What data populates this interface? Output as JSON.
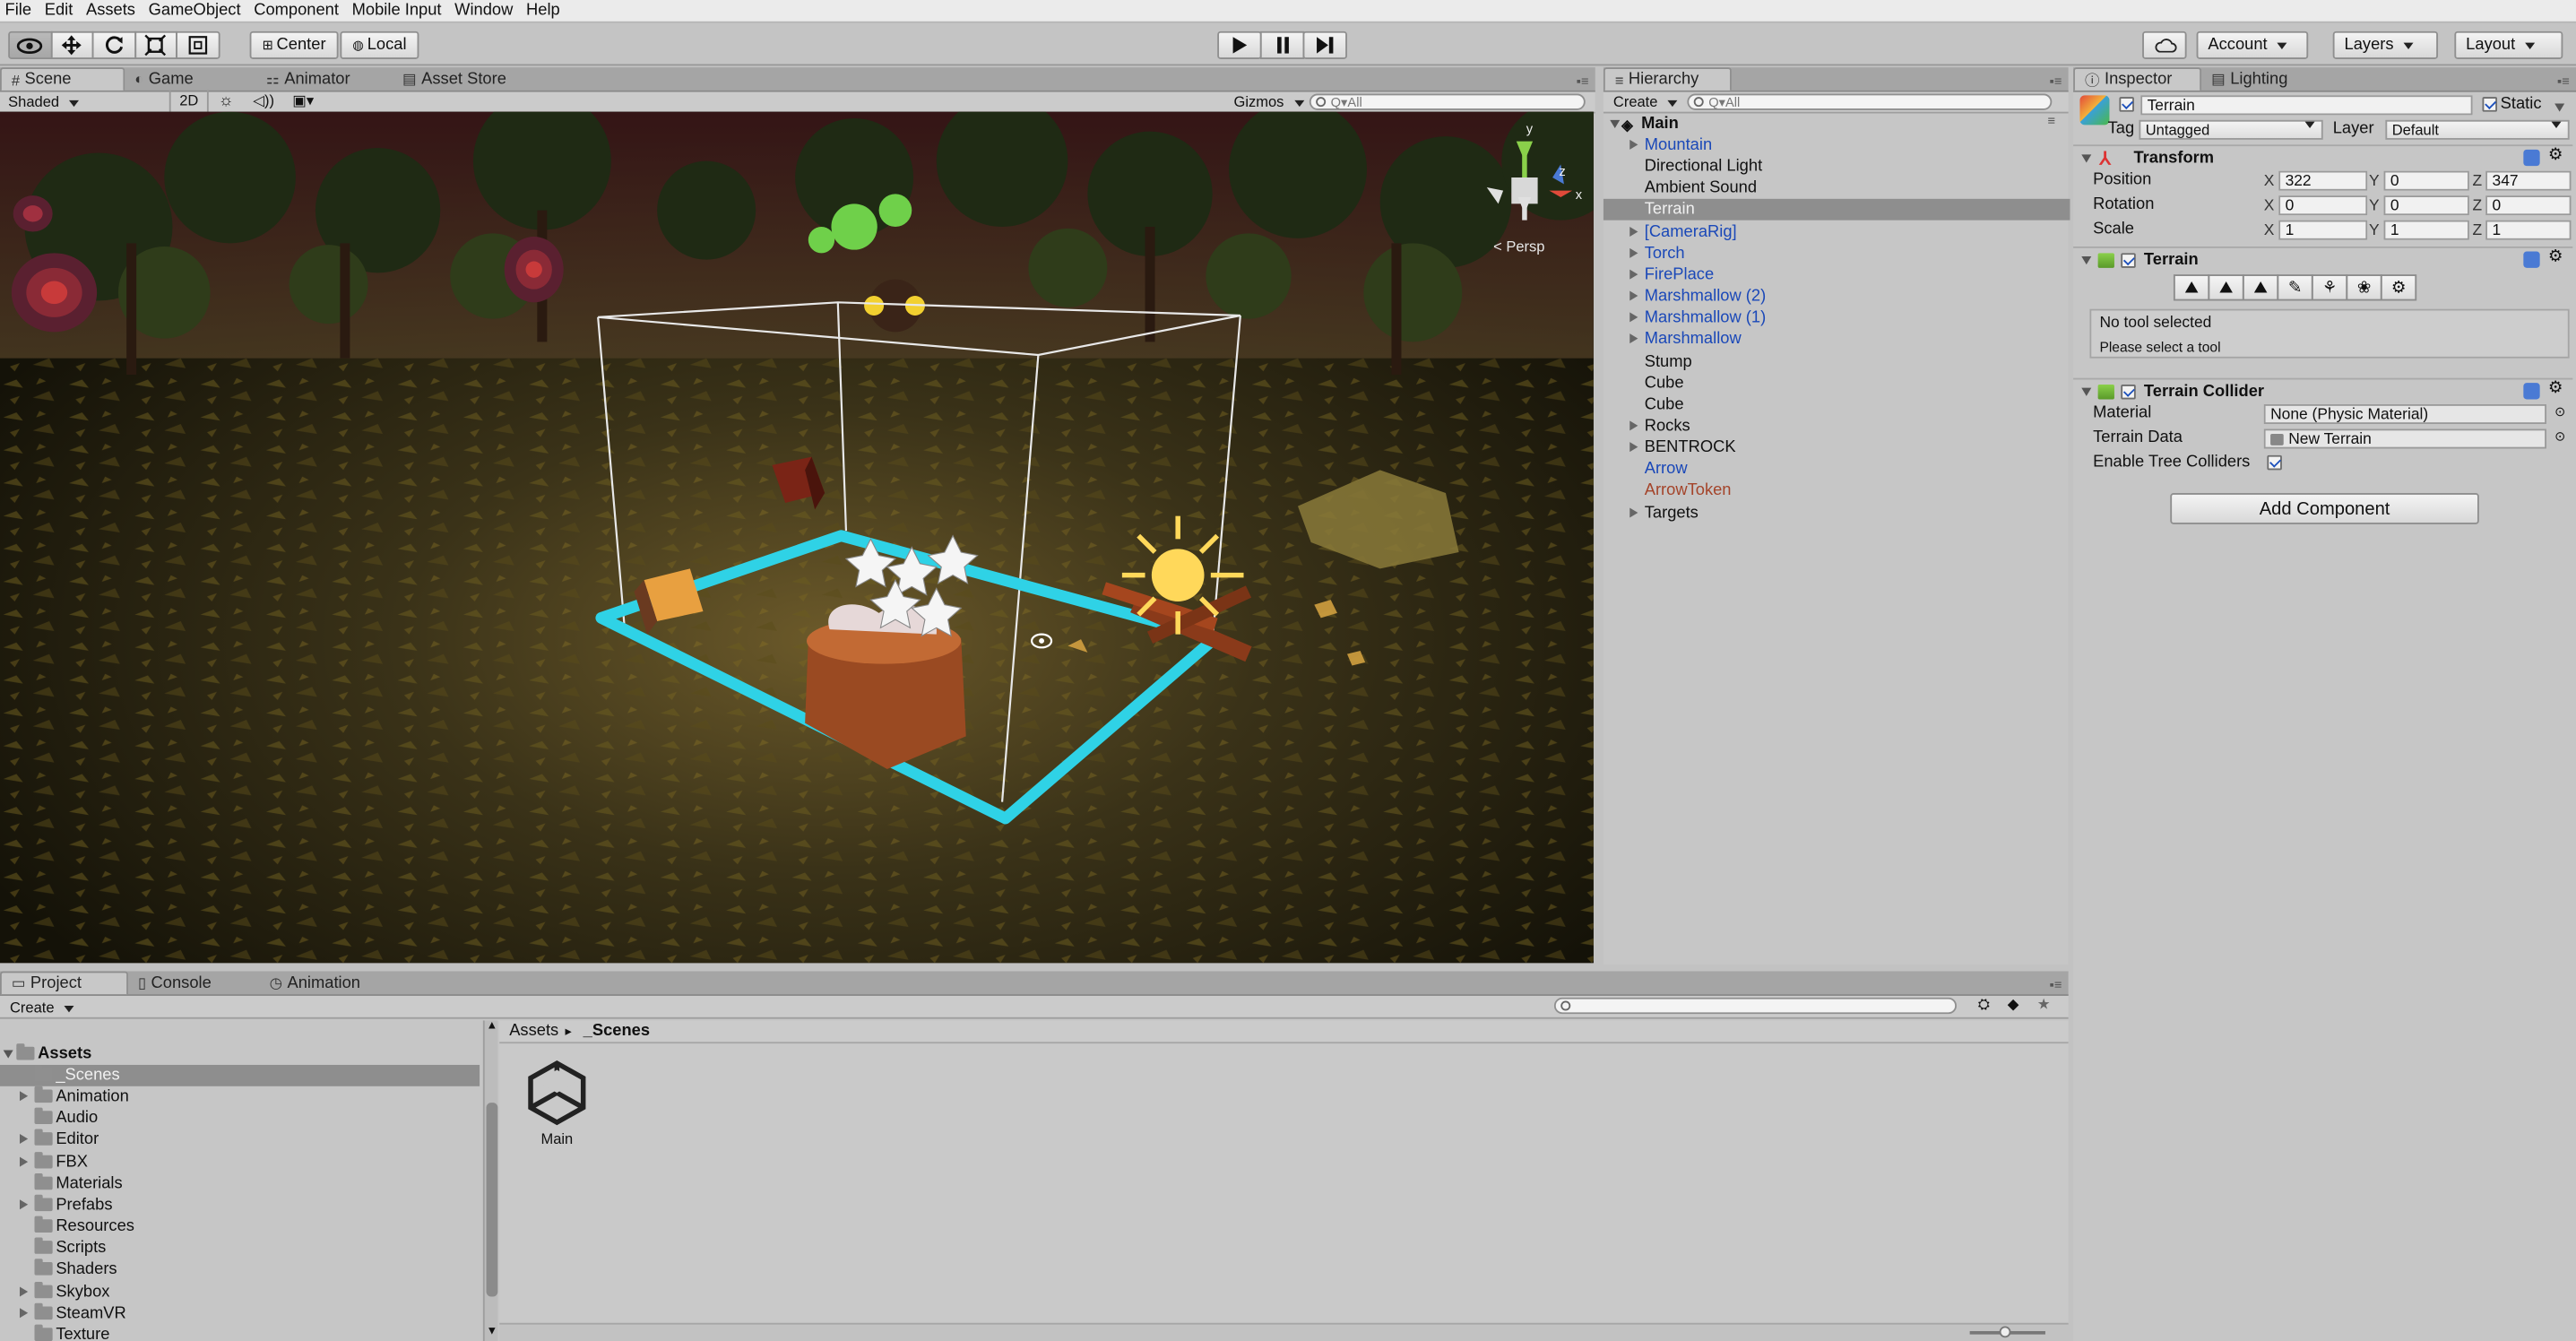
{
  "menu": [
    "File",
    "Edit",
    "Assets",
    "GameObject",
    "Component",
    "Mobile Input",
    "Window",
    "Help"
  ],
  "toolbar": {
    "tools": [
      "view-hand-icon",
      "move-icon",
      "rotate-icon",
      "scale-icon",
      "rect-icon"
    ],
    "pivot": "Center",
    "space": "Local",
    "account": "Account",
    "layers": "Layers",
    "layout": "Layout"
  },
  "scene": {
    "tabs": [
      "Scene",
      "Game",
      "Animator",
      "Asset Store"
    ],
    "shading": "Shaded",
    "mode2d": "2D",
    "gizmos": "Gizmos",
    "search_placeholder": "Q▾All",
    "persp": "Persp",
    "axis_y": "y",
    "axis_z": "z",
    "axis_x": "x"
  },
  "hierarchy": {
    "tab": "Hierarchy",
    "create": "Create",
    "search_placeholder": "Q▾All",
    "scene": "Main",
    "items": [
      {
        "label": "Mountain",
        "kind": "prefab",
        "expand": true
      },
      {
        "label": "Directional Light",
        "kind": "normal",
        "expand": false
      },
      {
        "label": "Ambient Sound",
        "kind": "normal",
        "expand": false
      },
      {
        "label": "Terrain",
        "kind": "normal",
        "expand": false,
        "selected": true
      },
      {
        "label": "[CameraRig]",
        "kind": "prefab",
        "expand": true
      },
      {
        "label": "Torch",
        "kind": "prefab",
        "expand": true
      },
      {
        "label": "FirePlace",
        "kind": "prefab",
        "expand": true
      },
      {
        "label": "Marshmallow (2)",
        "kind": "prefab",
        "expand": true
      },
      {
        "label": "Marshmallow (1)",
        "kind": "prefab",
        "expand": true
      },
      {
        "label": "Marshmallow",
        "kind": "prefab",
        "expand": true
      },
      {
        "label": "Stump",
        "kind": "normal",
        "expand": false
      },
      {
        "label": "Cube",
        "kind": "normal",
        "expand": false
      },
      {
        "label": "Cube",
        "kind": "normal",
        "expand": false
      },
      {
        "label": "Rocks",
        "kind": "normal",
        "expand": true
      },
      {
        "label": "BENTROCK",
        "kind": "normal",
        "expand": true
      },
      {
        "label": "Arrow",
        "kind": "prefab",
        "expand": false
      },
      {
        "label": "ArrowToken",
        "kind": "broken",
        "expand": false
      },
      {
        "label": "Targets",
        "kind": "normal",
        "expand": true
      }
    ]
  },
  "inspector": {
    "tabs": [
      "Inspector",
      "Lighting"
    ],
    "object_name": "Terrain",
    "static_label": "Static",
    "tag_label": "Tag",
    "tag_value": "Untagged",
    "layer_label": "Layer",
    "layer_value": "Default",
    "transform": {
      "title": "Transform",
      "position": {
        "label": "Position",
        "x": "322",
        "y": "0",
        "z": "347"
      },
      "rotation": {
        "label": "Rotation",
        "x": "0",
        "y": "0",
        "z": "0"
      },
      "scale": {
        "label": "Scale",
        "x": "1",
        "y": "1",
        "z": "1"
      }
    },
    "terrain": {
      "title": "Terrain",
      "tools": [
        "raise-terrain-icon",
        "paint-height-icon",
        "smooth-height-icon",
        "paint-texture-icon",
        "place-trees-icon",
        "paint-details-icon",
        "terrain-settings-icon"
      ],
      "msg1": "No tool selected",
      "msg2": "Please select a tool"
    },
    "collider": {
      "title": "Terrain Collider",
      "material_label": "Material",
      "material_value": "None (Physic Material)",
      "data_label": "Terrain Data",
      "data_value": "New Terrain",
      "trees_label": "Enable Tree Colliders"
    },
    "add_component": "Add Component"
  },
  "project": {
    "tabs": [
      "Project",
      "Console",
      "Animation"
    ],
    "create": "Create",
    "root": "Assets",
    "folders": [
      {
        "label": "_Scenes",
        "expand": false,
        "selected": true
      },
      {
        "label": "Animation",
        "expand": true
      },
      {
        "label": "Audio",
        "expand": false
      },
      {
        "label": "Editor",
        "expand": true
      },
      {
        "label": "FBX",
        "expand": true
      },
      {
        "label": "Materials",
        "expand": false
      },
      {
        "label": "Prefabs",
        "expand": true
      },
      {
        "label": "Resources",
        "expand": false
      },
      {
        "label": "Scripts",
        "expand": false
      },
      {
        "label": "Shaders",
        "expand": false
      },
      {
        "label": "Skybox",
        "expand": true
      },
      {
        "label": "SteamVR",
        "expand": true
      },
      {
        "label": "Texture",
        "expand": false
      }
    ],
    "breadcrumb_root": "Assets",
    "breadcrumb_sep": "▸",
    "breadcrumb_current": "_Scenes",
    "asset_name": "Main"
  },
  "colors": {
    "selection_cyan": "#2fd2e6",
    "prefab_blue": "#1a48b8",
    "broken_prefab": "#a4442a"
  }
}
